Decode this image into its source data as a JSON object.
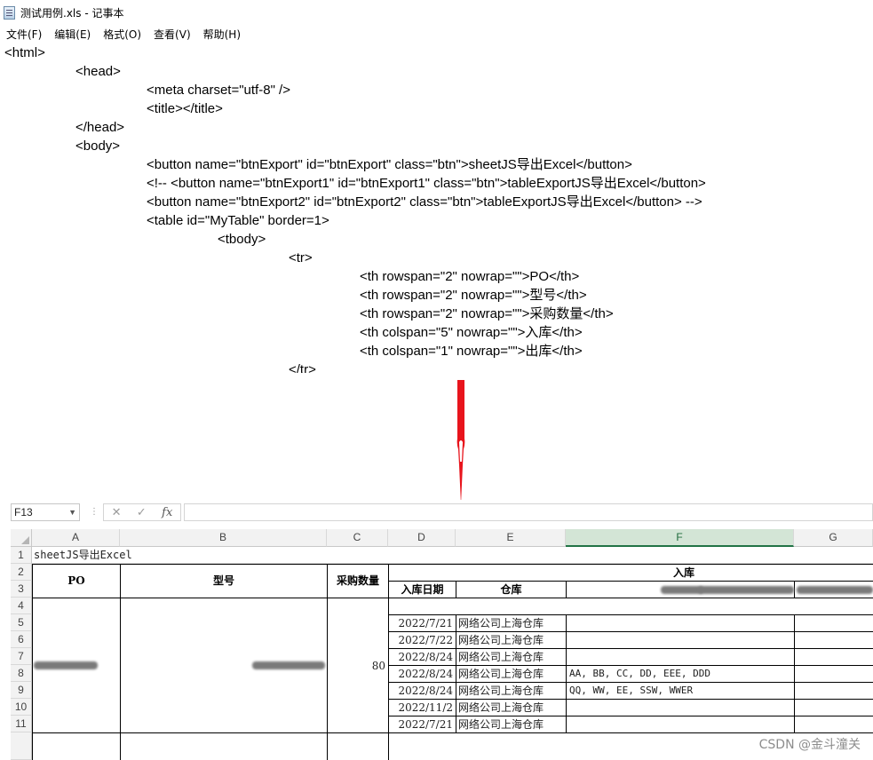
{
  "notepad": {
    "title": "测试用例.xls - 记事本",
    "menu": [
      "文件(F)",
      "编辑(E)",
      "格式(O)",
      "查看(V)",
      "帮助(H)"
    ],
    "lines": [
      "<html>",
      "<head>",
      "<meta charset=\"utf-8\" />",
      "<title></title>",
      "</head>",
      "<body>",
      "<button name=\"btnExport\" id=\"btnExport\" class=\"btn\">sheetJS导出Excel</button>",
      "<!-- <button name=\"btnExport1\" id=\"btnExport1\" class=\"btn\">tableExportJS导出Excel</button>",
      "<button name=\"btnExport2\" id=\"btnExport2\" class=\"btn\">tableExportJS导出Excel</button> -->",
      "<table id=\"MyTable\" border=1>",
      "<tbody>",
      "<tr>",
      "<th rowspan=\"2\" nowrap=\"\">PO</th>",
      "<th rowspan=\"2\" nowrap=\"\">型号</th>",
      "<th rowspan=\"2\" nowrap=\"\">采购数量</th>",
      "<th colspan=\"5\" nowrap=\"\">入库</th>",
      "<th colspan=\"1\" nowrap=\"\">出库</th>",
      "</tr>"
    ]
  },
  "excel": {
    "namebox": "F13",
    "formula_buttons": [
      "✕",
      "✓",
      "fx"
    ],
    "columns": [
      "A",
      "B",
      "C",
      "D",
      "E",
      "F",
      "G"
    ],
    "rows": [
      "1",
      "2",
      "3",
      "4",
      "5",
      "6",
      "7",
      "8",
      "9",
      "10",
      "11"
    ],
    "a1": "sheetJS导出Excel",
    "header": {
      "po": "PO",
      "model": "型号",
      "qty": "采购数量",
      "inbound": "入库",
      "in_date": "入库日期",
      "warehouse": "仓库"
    },
    "qty_value": "80",
    "data_rows": [
      {
        "date": "2022/7/21",
        "warehouse": "网络公司上海仓库",
        "f": ""
      },
      {
        "date": "2022/7/22",
        "warehouse": "网络公司上海仓库",
        "f": ""
      },
      {
        "date": "2022/8/24",
        "warehouse": "网络公司上海仓库",
        "f": ""
      },
      {
        "date": "2022/8/24",
        "warehouse": "网络公司上海仓库",
        "f": "AA, BB, CC, DD, EEE, DDD"
      },
      {
        "date": "2022/8/24",
        "warehouse": "网络公司上海仓库",
        "f": "QQ, WW, EE, SSW, WWER"
      },
      {
        "date": "2022/11/2",
        "warehouse": "网络公司上海仓库",
        "f": ""
      },
      {
        "date": "2022/7/21",
        "warehouse": "网络公司上海仓库",
        "f": ""
      }
    ]
  },
  "watermark": "CSDN @金斗潼关",
  "colors": {
    "arrow": "#e8141c",
    "excel_selected": "#217346"
  }
}
